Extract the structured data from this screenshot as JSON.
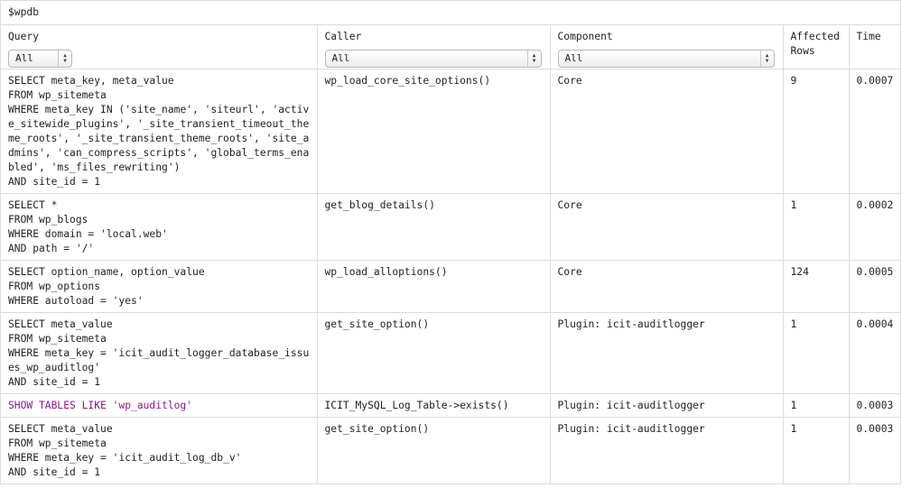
{
  "caption": "$wpdb",
  "columns": {
    "query": "Query",
    "caller": "Caller",
    "component": "Component",
    "affected": "Affected Rows",
    "time": "Time"
  },
  "filters": {
    "query": "All",
    "caller": "All",
    "component": "All"
  },
  "rows": [
    {
      "query": "SELECT meta_key, meta_value\nFROM wp_sitemeta\nWHERE meta_key IN ('site_name', 'siteurl', 'active_sitewide_plugins', '_site_transient_timeout_theme_roots', '_site_transient_theme_roots', 'site_admins', 'can_compress_scripts', 'global_terms_enabled', 'ms_files_rewriting')\nAND site_id = 1",
      "caller": "wp_load_core_site_options()",
      "component": "Core",
      "affected": "9",
      "time": "0.0007"
    },
    {
      "query": "SELECT *\nFROM wp_blogs\nWHERE domain = 'local.web'\nAND path = '/'",
      "caller": "get_blog_details()",
      "component": "Core",
      "affected": "1",
      "time": "0.0002"
    },
    {
      "query": "SELECT option_name, option_value\nFROM wp_options\nWHERE autoload = 'yes'",
      "caller": "wp_load_alloptions()",
      "component": "Core",
      "affected": "124",
      "time": "0.0005"
    },
    {
      "query": "SELECT meta_value\nFROM wp_sitemeta\nWHERE meta_key = 'icit_audit_logger_database_issues_wp_auditlog'\nAND site_id = 1",
      "caller": "get_site_option()",
      "component": "Plugin: icit-auditlogger",
      "affected": "1",
      "time": "0.0004"
    },
    {
      "query": "SHOW TABLES LIKE 'wp_auditlog'",
      "caller": "ICIT_MySQL_Log_Table->exists()",
      "component": "Plugin: icit-auditlogger",
      "affected": "1",
      "time": "0.0003"
    },
    {
      "query": "SELECT meta_value\nFROM wp_sitemeta\nWHERE meta_key = 'icit_audit_log_db_v'\nAND site_id = 1",
      "caller": "get_site_option()",
      "component": "Plugin: icit-auditlogger",
      "affected": "1",
      "time": "0.0003"
    }
  ],
  "colors": {
    "border": "#dcdcdc",
    "non_select_query": "#8b1a8b"
  },
  "icons": {
    "select_arrow": "up-down-chevron-icon"
  }
}
